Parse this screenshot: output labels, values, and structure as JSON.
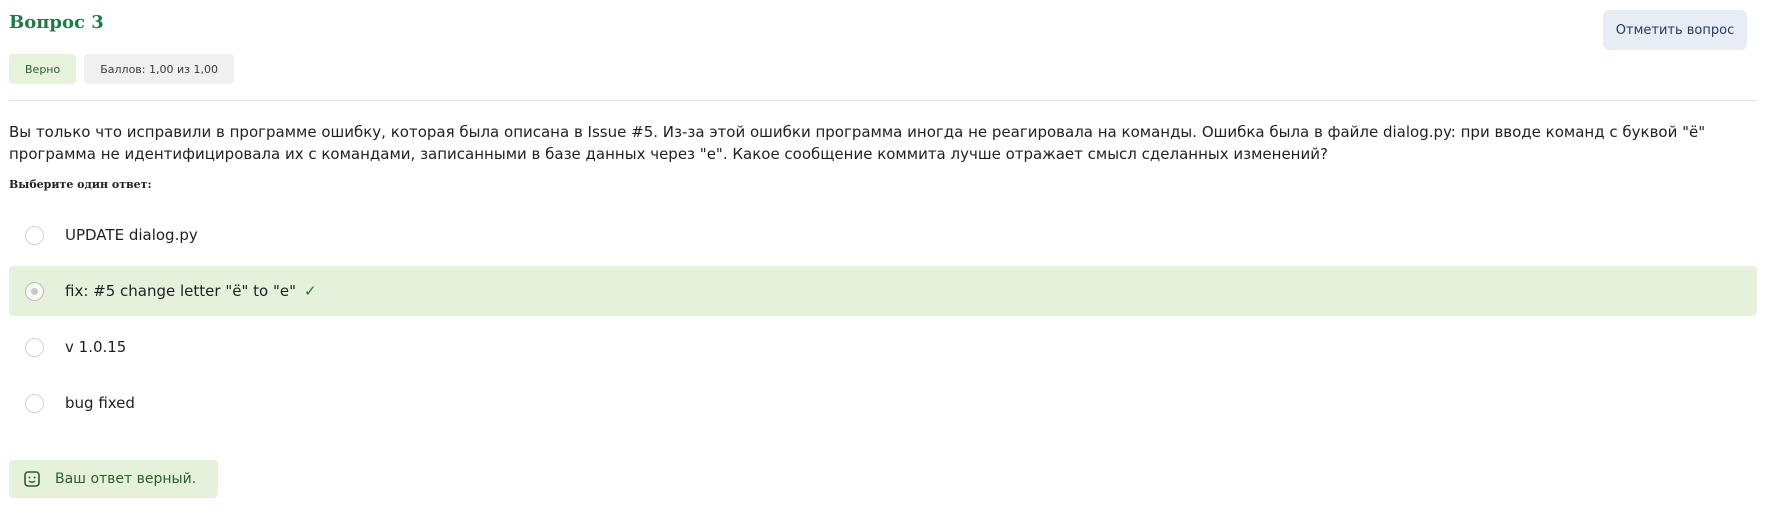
{
  "question": {
    "title": "Вопрос 3",
    "flag_label": "Отметить вопрос",
    "state": "Верно",
    "grade": "Баллов: 1,00 из 1,00",
    "text": "Вы только что исправили в программе ошибку, которая была описана в Issue #5. Из-за этой ошибки программа иногда не реагировала на команды. Ошибка была в файле dialog.py: при вводе команд с буквой \"ё\" программа не идентифицировала их с командами, записанными в базе данных через \"е\". Какое сообщение коммита лучше отражает смысл сделанных изменений?",
    "prompt": "Выберите один ответ:",
    "options": [
      {
        "label": "UPDATE dialog.py",
        "correct": false
      },
      {
        "label": "fix: #5 change letter \"ё\" to \"e\"",
        "correct": true
      },
      {
        "label": "v 1.0.15",
        "correct": false
      },
      {
        "label": "bug fixed",
        "correct": false
      }
    ],
    "feedback": "Ваш ответ верный."
  },
  "colors": {
    "title": "#1f7a4a",
    "correct_bg": "#e6f1dc",
    "flag_bg": "#e8ecf5"
  },
  "icons": {
    "check": "check-icon",
    "feedback": "smile-icon",
    "radio": "radio-icon"
  }
}
